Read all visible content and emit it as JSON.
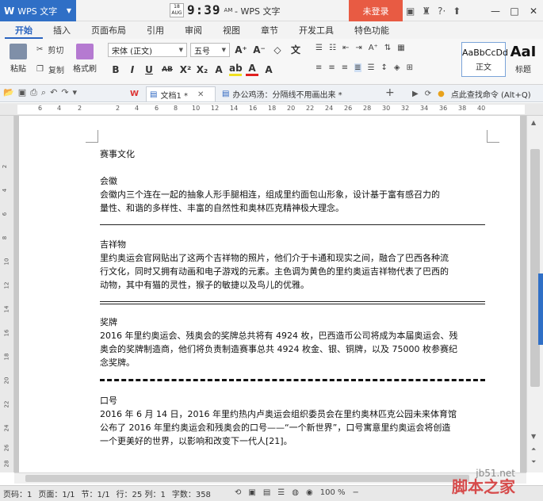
{
  "titlebar": {
    "app_name": "WPS 文字",
    "clock_date_top": "18",
    "clock_date_bottom": "AUG",
    "clock_time": "9:39",
    "clock_ampm": "AM",
    "window_title": "- WPS 文字",
    "login_label": "未登录"
  },
  "menu": {
    "tabs": [
      "开始",
      "插入",
      "页面布局",
      "引用",
      "审阅",
      "视图",
      "章节",
      "开发工具",
      "特色功能"
    ]
  },
  "ribbon": {
    "paste_label": "粘贴",
    "cut_label": "剪切",
    "copy_label": "复制",
    "format_painter_label": "格式刷",
    "font_name": "宋体 (正文)",
    "font_size": "五号",
    "style_normal_sample": "AaBbCcDd",
    "style_normal_label": "正文",
    "style_heading_sample": "AaI",
    "style_heading_label": "标题"
  },
  "docbar": {
    "tab1_label": "文档1 *",
    "tab2_label": "办公鸡汤：分隔线不用画出来 *",
    "search_command": "点此查找命令 (Alt+Q)"
  },
  "ruler_ticks": [
    "6",
    "4",
    "2",
    "2",
    "4",
    "6",
    "8",
    "10",
    "12",
    "14",
    "16",
    "18",
    "20",
    "22",
    "24",
    "26",
    "28",
    "30",
    "32",
    "34",
    "36",
    "38",
    "40"
  ],
  "ruler_v_ticks": [
    "2",
    "4",
    "6",
    "8",
    "10",
    "12",
    "14",
    "16",
    "18",
    "20",
    "22",
    "24",
    "26",
    "28"
  ],
  "document": {
    "title": "赛事文化",
    "s1_heading": "会徽",
    "s1_line1": "会徽内三个连在一起的抽象人形手腿相连，组成里约面包山形象，设计基于富有感召力的",
    "s1_line2": "量性、和谐的多样性、丰富的自然性和奥林匹克精神极大理念。",
    "s2_heading": "吉祥物",
    "s2_line1": "里约奥运会官网贴出了这两个吉祥物的照片，他们介于卡通和现实之间，融合了巴西各种流",
    "s2_line2": "行文化，同时又拥有动画和电子游戏的元素。主色调为黄色的里约奥运吉祥物代表了巴西的",
    "s2_line3": "动物，其中有猫的灵性，猴子的敏捷以及鸟儿的优雅。",
    "s3_heading": "奖牌",
    "s3_line1": "2016 年里约奥运会、残奥会的奖牌总共将有 4924 枚，巴西造币公司将成为本届奥运会、残",
    "s3_line2": "奥会的奖牌制造商，他们将负责制造赛事总共 4924 枚金、银、铜牌，以及 75000 枚参赛纪",
    "s3_line3": "念奖牌。",
    "s4_heading": "口号",
    "s4_line1": "2016 年 6 月 14 日，2016 年里约热内卢奥运会组织委员会在里约奥林匹克公园未来体育馆",
    "s4_line2": "公布了 2016 年里约奥运会和残奥会的口号——“一个新世界”，口号寓意里约奥运会将创造",
    "s4_line3": "一个更美好的世界，以影响和改变下一代人[21]。"
  },
  "status": {
    "page_num": "页码：1",
    "page_count": "页面：1/1",
    "section": "节：1/1",
    "row_col": "行：25  列：1",
    "word_count": "字数：358",
    "zoom": "100 %"
  },
  "watermark": {
    "site": "jb51.net",
    "name": "脚本之家"
  }
}
